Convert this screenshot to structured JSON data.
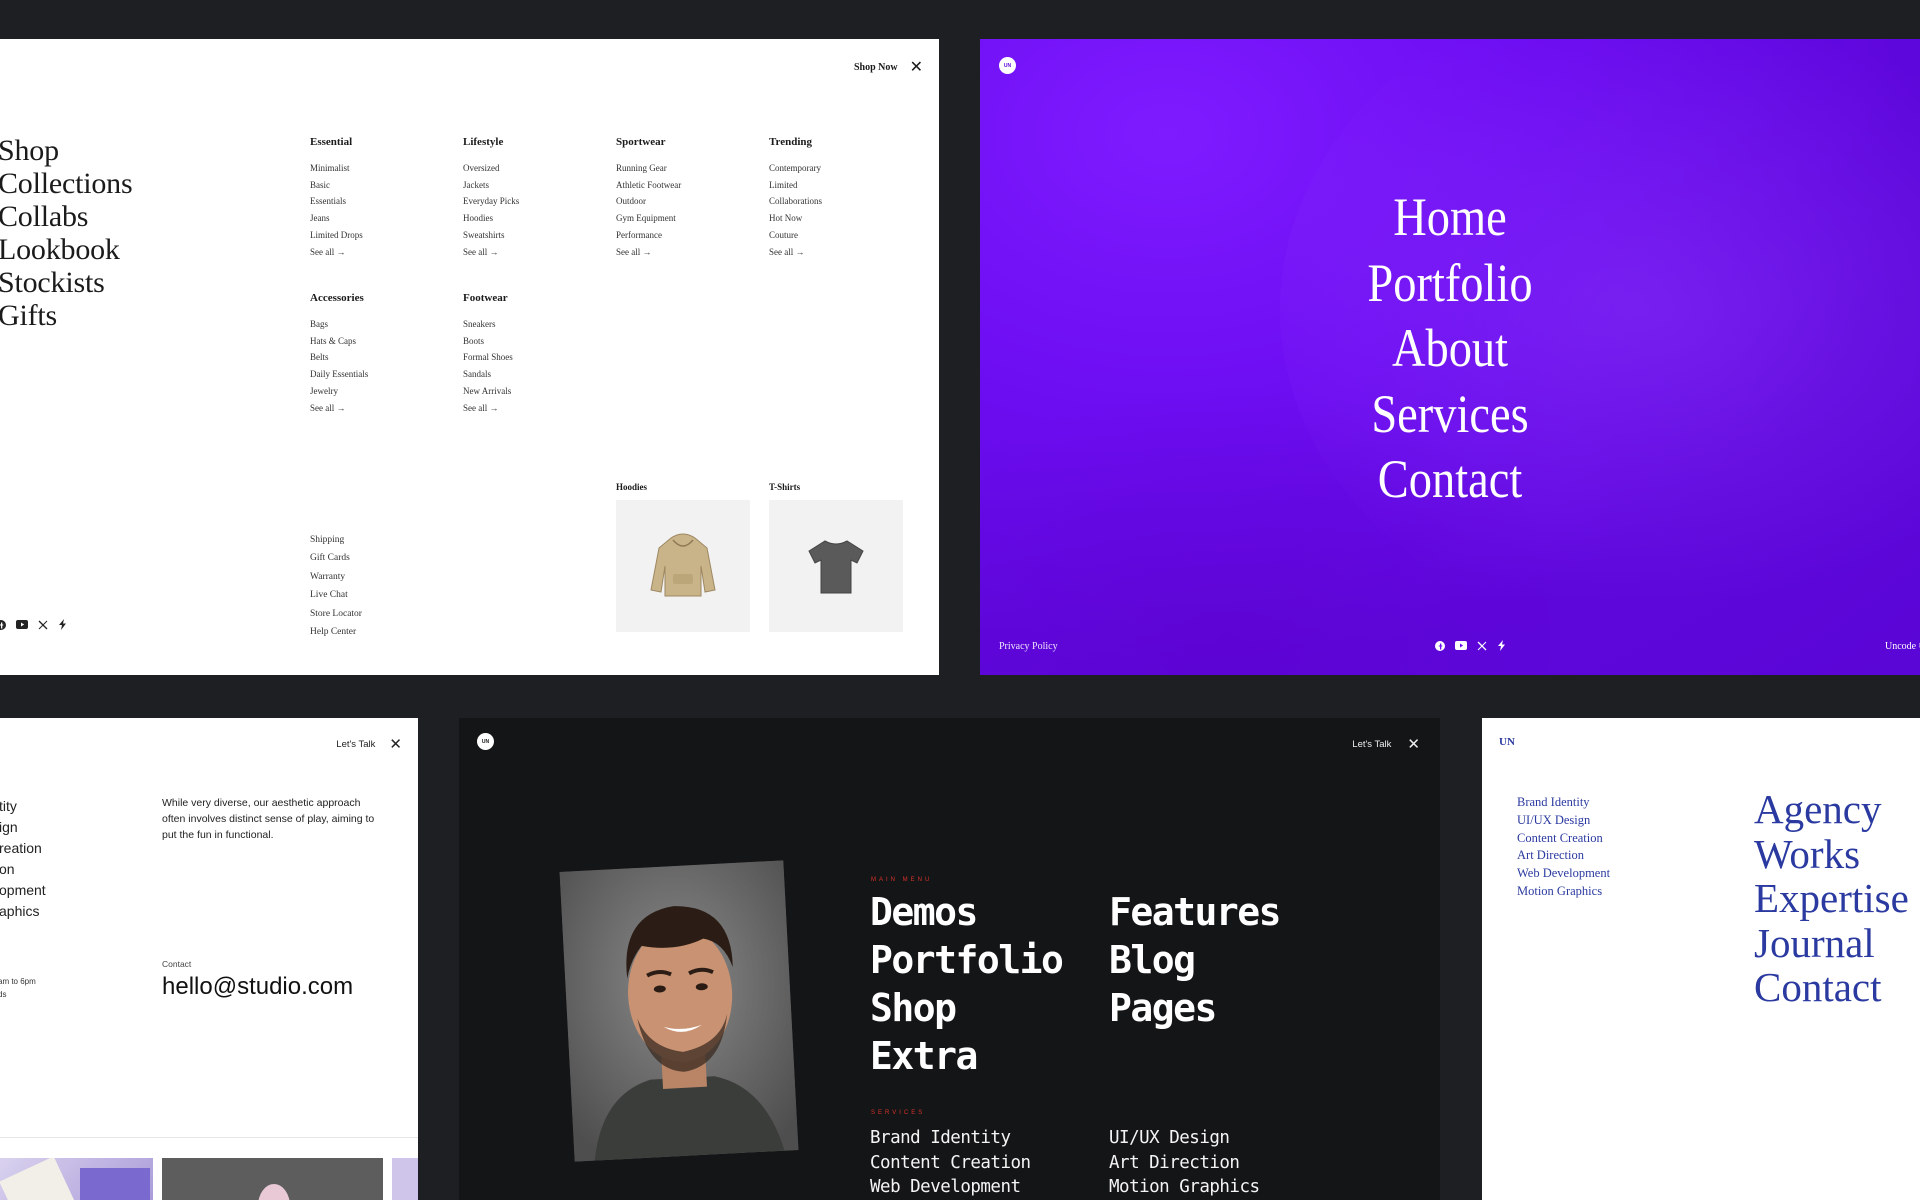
{
  "panel_shop": {
    "shop_now": "Shop Now",
    "main_nav": [
      "Shop",
      "Collections",
      "Collabs",
      "Lookbook",
      "Stockists",
      "Gifts"
    ],
    "columns": [
      {
        "title": "Essential",
        "items": [
          "Minimalist",
          "Basic",
          "Essentials",
          "Jeans",
          "Limited Drops",
          "See all →"
        ]
      },
      {
        "title": "Lifestyle",
        "items": [
          "Oversized",
          "Jackets",
          "Everyday Picks",
          "Hoodies",
          "Sweatshirts",
          "See all →"
        ]
      },
      {
        "title": "Sportwear",
        "items": [
          "Running Gear",
          "Athletic Footwear",
          "Outdoor",
          "Gym Equipment",
          "Performance",
          "See all →"
        ]
      },
      {
        "title": "Trending",
        "items": [
          "Contemporary",
          "Limited",
          "Collaborations",
          "Hot Now",
          "Couture",
          "See all →"
        ]
      },
      {
        "title": "Accessories",
        "items": [
          "Bags",
          "Hats & Caps",
          "Belts",
          "Daily Essentials",
          "Jewelry",
          "See all →"
        ]
      },
      {
        "title": "Footwear",
        "items": [
          "Sneakers",
          "Boots",
          "Formal Shoes",
          "Sandals",
          "New Arrivals",
          "See all →"
        ]
      }
    ],
    "footer_links": [
      "Shipping",
      "Gift Cards",
      "Warranty",
      "Live Chat",
      "Store Locator",
      "Help Center"
    ],
    "products": [
      {
        "label": "Hoodies",
        "icon": "hoodie-icon",
        "color": "#c9b48a"
      },
      {
        "label": "T-Shirts",
        "icon": "tshirt-icon",
        "color": "#5a5a5a"
      }
    ],
    "socials": [
      "facebook-icon",
      "youtube-icon",
      "x-icon",
      "bolt-icon"
    ]
  },
  "panel_purple": {
    "logo": "UN",
    "nav": [
      "Home",
      "Portfolio",
      "About",
      "Services",
      "Contact"
    ],
    "privacy": "Privacy Policy",
    "credit": "Uncode ©",
    "accent": "#6d0df2",
    "socials": [
      "facebook-icon",
      "youtube-icon",
      "x-icon",
      "bolt-icon"
    ]
  },
  "panel_talk": {
    "lets_talk": "Let's Talk",
    "list": [
      "tity",
      "ign",
      "reation",
      "on",
      "opment",
      "aphics"
    ],
    "description": "While very diverse, our aesthetic approach often involves distinct sense of play, aiming to put the fun in functional.",
    "hours": [
      "am to 6pm",
      "ds"
    ],
    "contact_label": "Contact",
    "email": "hello@studio.com"
  },
  "panel_dark": {
    "logo": "UN",
    "lets_talk": "Let's Talk",
    "main_menu_label": "Main Menu",
    "menu_col1": [
      "Demos",
      "Portfolio",
      "Shop",
      "Extra"
    ],
    "menu_col2": [
      "Features",
      "Blog",
      "Pages"
    ],
    "services_label": "Services",
    "services_col1": [
      "Brand Identity",
      "Content Creation",
      "Web Development"
    ],
    "services_col2": [
      "UI/UX Design",
      "Art Direction",
      "Motion Graphics"
    ],
    "eyebrow_color": "#d8322a"
  },
  "panel_blue": {
    "logo": "UN",
    "services": [
      "Brand Identity",
      "UI/UX Design",
      "Content Creation",
      "Art Direction",
      "Web Development",
      "Motion Graphics"
    ],
    "nav": [
      "Agency",
      "Works",
      "Expertise",
      "Journal",
      "Contact"
    ],
    "color": "#2b3aa0"
  }
}
